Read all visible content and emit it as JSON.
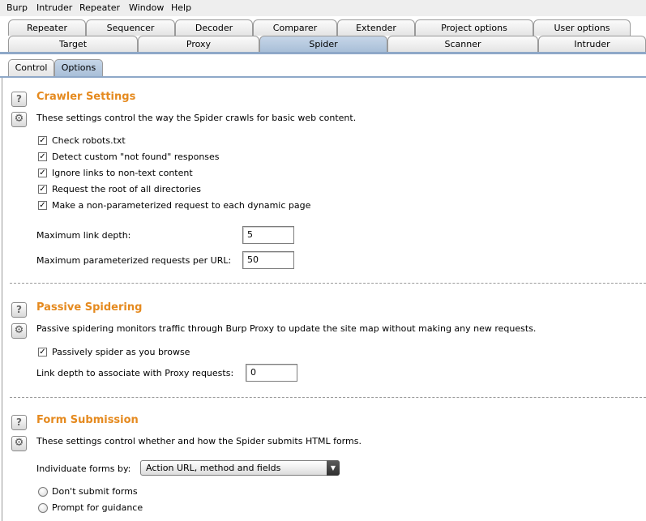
{
  "menubar": {
    "items": [
      "Burp",
      "Intruder",
      "Repeater",
      "Window",
      "Help"
    ]
  },
  "tabs": {
    "row1": [
      "Repeater",
      "Sequencer",
      "Decoder",
      "Comparer",
      "Extender",
      "Project options",
      "User options"
    ],
    "row2": [
      "Target",
      "Proxy",
      "Spider",
      "Scanner",
      "Intruder"
    ],
    "selected": "Spider"
  },
  "subtabs": {
    "items": [
      "Control",
      "Options"
    ],
    "selected": "Options"
  },
  "icons": {
    "help": "?",
    "gear": "⚙"
  },
  "crawler": {
    "title": "Crawler Settings",
    "description": "These settings control the way the Spider crawls for basic web content.",
    "options": [
      {
        "label": "Check robots.txt",
        "checked": true
      },
      {
        "label": "Detect custom \"not found\" responses",
        "checked": true
      },
      {
        "label": "Ignore links to non-text content",
        "checked": true
      },
      {
        "label": "Request the root of all directories",
        "checked": true
      },
      {
        "label": "Make a non-parameterized request to each dynamic page",
        "checked": true
      }
    ],
    "max_link_depth_label": "Maximum link depth:",
    "max_link_depth": "5",
    "max_param_label": "Maximum parameterized requests per URL:",
    "max_param": "50"
  },
  "passive": {
    "title": "Passive Spidering",
    "description": "Passive spidering monitors traffic through Burp Proxy to update the site map without making any new requests.",
    "option_label": "Passively spider as you browse",
    "option_checked": true,
    "depth_label": "Link depth to associate with Proxy requests:",
    "depth": "0"
  },
  "form": {
    "title": "Form Submission",
    "description": "These settings control whether and how the Spider submits HTML forms.",
    "individuate_label": "Individuate forms by:",
    "individuate_value": "Action URL, method and fields",
    "radios": [
      {
        "label": "Don't submit forms",
        "selected": false
      },
      {
        "label": "Prompt for guidance",
        "selected": false
      }
    ]
  },
  "check_glyph": "✓",
  "dropdown_glyph": "▼"
}
